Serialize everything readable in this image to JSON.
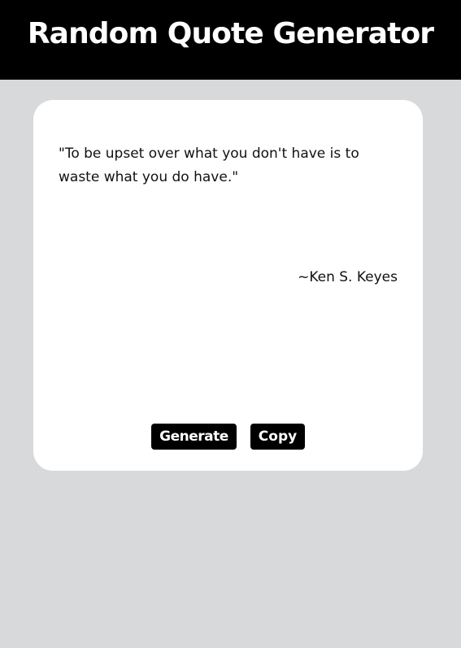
{
  "header": {
    "title": "Random Quote Generator"
  },
  "quote": {
    "text": "\"To be upset over what you don't have is to waste what you do have.\"",
    "author": "~Ken S. Keyes"
  },
  "buttons": {
    "generate_label": "Generate",
    "copy_label": "Copy"
  },
  "colors": {
    "header_bg": "#000000",
    "page_bg": "#d8d9db",
    "card_bg": "#ffffff",
    "button_bg": "#000000",
    "button_text": "#ffffff"
  }
}
